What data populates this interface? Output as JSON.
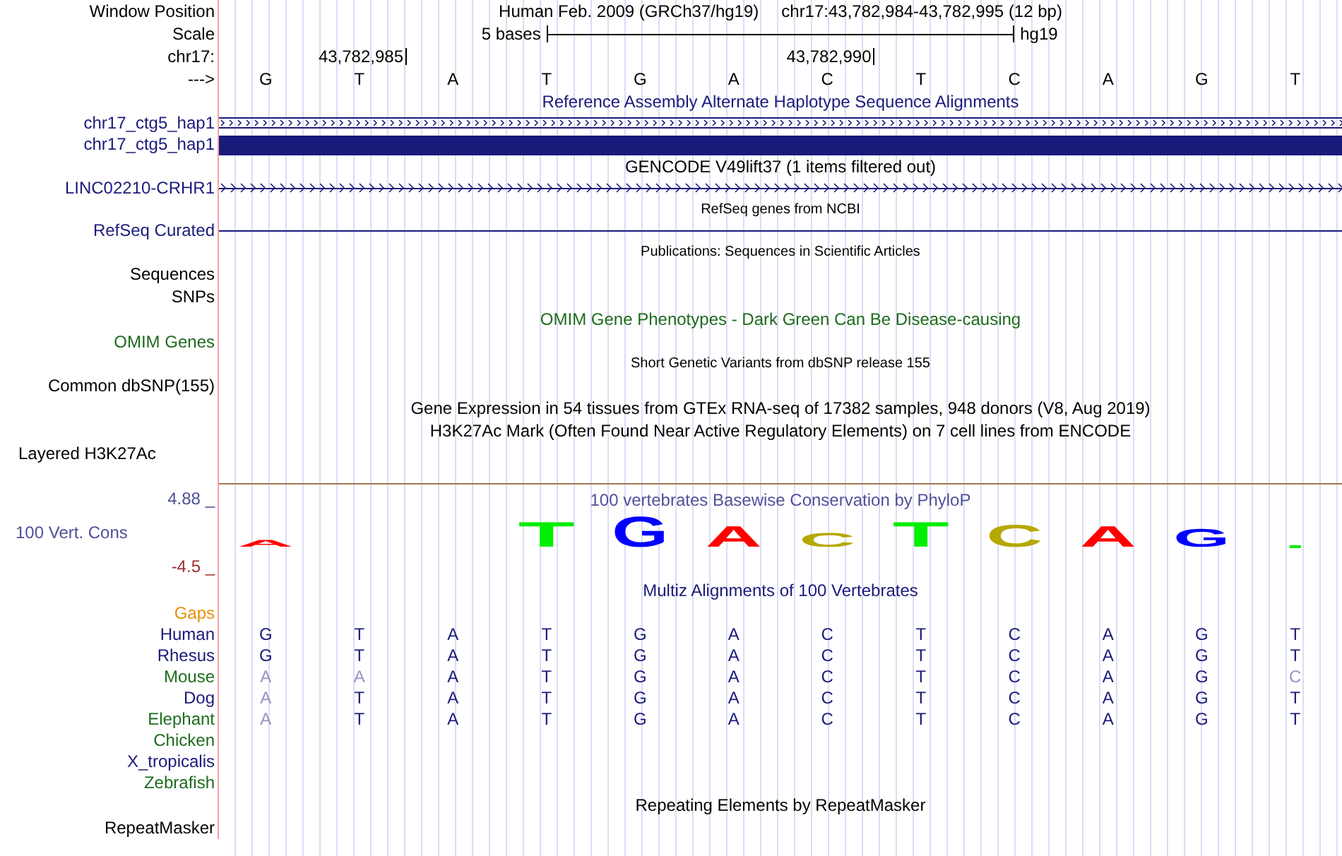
{
  "ruler": {
    "window_label": "Window Position",
    "assembly_title": "Human Feb. 2009 (GRCh37/hg19)",
    "position": "chr17:43,782,984-43,782,995 (12 bp)",
    "scale_label": "Scale",
    "scale_text": "5 bases",
    "scale_assembly": "hg19",
    "chrom_label": "chr17:",
    "strand_label": "--->",
    "positions": [
      {
        "base": "G"
      },
      {
        "base": "T",
        "tick": "43,782,985"
      },
      {
        "base": "A"
      },
      {
        "base": "T"
      },
      {
        "base": "G"
      },
      {
        "base": "A"
      },
      {
        "base": "C",
        "tick": "43,782,990"
      },
      {
        "base": "T"
      },
      {
        "base": "C"
      },
      {
        "base": "A"
      },
      {
        "base": "G"
      },
      {
        "base": "T"
      }
    ]
  },
  "tracks": [
    {
      "kind": "title",
      "text": "Reference Assembly Alternate Haplotype Sequence Alignments",
      "color": "#1a1a7a"
    },
    {
      "kind": "alignment",
      "label": "chr17_ctg5_hap1",
      "color": "#1a1a7a"
    },
    {
      "kind": "block",
      "label": "chr17_ctg5_hap1",
      "color": "#1a1a7a"
    },
    {
      "kind": "title",
      "text": "GENCODE V49lift37 (1 items filtered out)",
      "color": "#000000"
    },
    {
      "kind": "gene",
      "label": "LINC02210-CRHR1",
      "color": "#1a1a7a"
    },
    {
      "kind": "note",
      "text": "RefSeq genes from NCBI"
    },
    {
      "kind": "line",
      "label": "RefSeq Curated",
      "color": "#1a1a7a"
    },
    {
      "kind": "note",
      "text": "Publications: Sequences in Scientific Articles"
    },
    {
      "kind": "label",
      "label": "Sequences",
      "color": "#000000"
    },
    {
      "kind": "label",
      "label": "SNPs",
      "color": "#000000"
    },
    {
      "kind": "title",
      "text": "OMIM Gene Phenotypes - Dark Green Can Be Disease-causing",
      "color": "#1e6b1e"
    },
    {
      "kind": "label",
      "label": "OMIM Genes",
      "color": "#1e6b1e"
    },
    {
      "kind": "note",
      "text": "Short Genetic Variants from dbSNP release 155"
    },
    {
      "kind": "label",
      "label": "Common dbSNP(155)",
      "color": "#000000"
    },
    {
      "kind": "title",
      "text": "Gene Expression in 54 tissues from GTEx RNA-seq of 17382 samples, 948 donors (V8, Aug 2019)",
      "color": "#000000"
    },
    {
      "kind": "title",
      "text": "H3K27Ac Mark (Often Found Near Active Regulatory Elements) on 7 cell lines from ENCODE",
      "color": "#000000"
    },
    {
      "kind": "composite",
      "label": "Layered H3K27Ac",
      "color": "#000000"
    },
    {
      "kind": "conservation",
      "title": "100 vertebrates Basewise Conservation by PhyloP",
      "label": "100 Vert. Cons",
      "max": "4.88 _",
      "min": "-4.5 _",
      "logo": [
        {
          "kind": "letter",
          "letter": "A",
          "color": "#ff0000"
        },
        {
          "kind": "blank"
        },
        {
          "kind": "blank"
        },
        {
          "kind": "letter",
          "letter": "T",
          "color": "#00ee00"
        },
        {
          "kind": "letter",
          "letter": "G",
          "color": "#0000ff"
        },
        {
          "kind": "letter",
          "letter": "A",
          "color": "#ff0000"
        },
        {
          "kind": "letter",
          "letter": "C",
          "color": "#b5a800"
        },
        {
          "kind": "letter",
          "letter": "T",
          "color": "#00ee00"
        },
        {
          "kind": "letter",
          "letter": "C",
          "color": "#b5a800"
        },
        {
          "kind": "letter",
          "letter": "A",
          "color": "#ff0000"
        },
        {
          "kind": "letter",
          "letter": "G",
          "color": "#0000ff"
        },
        {
          "kind": "mark",
          "color": "#00ee00"
        }
      ]
    },
    {
      "kind": "title",
      "text": "Multiz Alignments of 100 Vertebrates",
      "color": "#1a1a7a"
    },
    {
      "kind": "label",
      "label": "Gaps",
      "color": "#e8900a"
    },
    {
      "kind": "species",
      "label": "Human",
      "color": "#1a1a7a",
      "bases": [
        "G",
        "T",
        "A",
        "T",
        "G",
        "A",
        "C",
        "T",
        "C",
        "A",
        "G",
        "T"
      ],
      "differs": [
        false,
        false,
        false,
        false,
        false,
        false,
        false,
        false,
        false,
        false,
        false,
        false
      ]
    },
    {
      "kind": "species",
      "label": "Rhesus",
      "color": "#1a1a7a",
      "bases": [
        "G",
        "T",
        "A",
        "T",
        "G",
        "A",
        "C",
        "T",
        "C",
        "A",
        "G",
        "T"
      ],
      "differs": [
        false,
        false,
        false,
        false,
        false,
        false,
        false,
        false,
        false,
        false,
        false,
        false
      ]
    },
    {
      "kind": "species",
      "label": "Mouse",
      "color": "#1e6b1e",
      "bases": [
        "A",
        "A",
        "A",
        "T",
        "G",
        "A",
        "C",
        "T",
        "C",
        "A",
        "G",
        "C"
      ],
      "differs": [
        true,
        true,
        false,
        false,
        false,
        false,
        false,
        false,
        false,
        false,
        false,
        true
      ]
    },
    {
      "kind": "species",
      "label": "Dog",
      "color": "#1a1a7a",
      "bases": [
        "A",
        "T",
        "A",
        "T",
        "G",
        "A",
        "C",
        "T",
        "C",
        "A",
        "G",
        "T"
      ],
      "differs": [
        true,
        false,
        false,
        false,
        false,
        false,
        false,
        false,
        false,
        false,
        false,
        false
      ]
    },
    {
      "kind": "species",
      "label": "Elephant",
      "color": "#1e6b1e",
      "bases": [
        "A",
        "T",
        "A",
        "T",
        "G",
        "A",
        "C",
        "T",
        "C",
        "A",
        "G",
        "T"
      ],
      "differs": [
        true,
        false,
        false,
        false,
        false,
        false,
        false,
        false,
        false,
        false,
        false,
        false
      ]
    },
    {
      "kind": "species",
      "label": "Chicken",
      "color": "#1e6b1e"
    },
    {
      "kind": "species",
      "label": "X_tropicalis",
      "color": "#1a1a7a"
    },
    {
      "kind": "species",
      "label": "Zebrafish",
      "color": "#1e6b1e"
    },
    {
      "kind": "title",
      "text": "Repeating Elements by RepeatMasker",
      "color": "#000000"
    },
    {
      "kind": "label",
      "label": "RepeatMasker",
      "color": "#000000"
    }
  ]
}
